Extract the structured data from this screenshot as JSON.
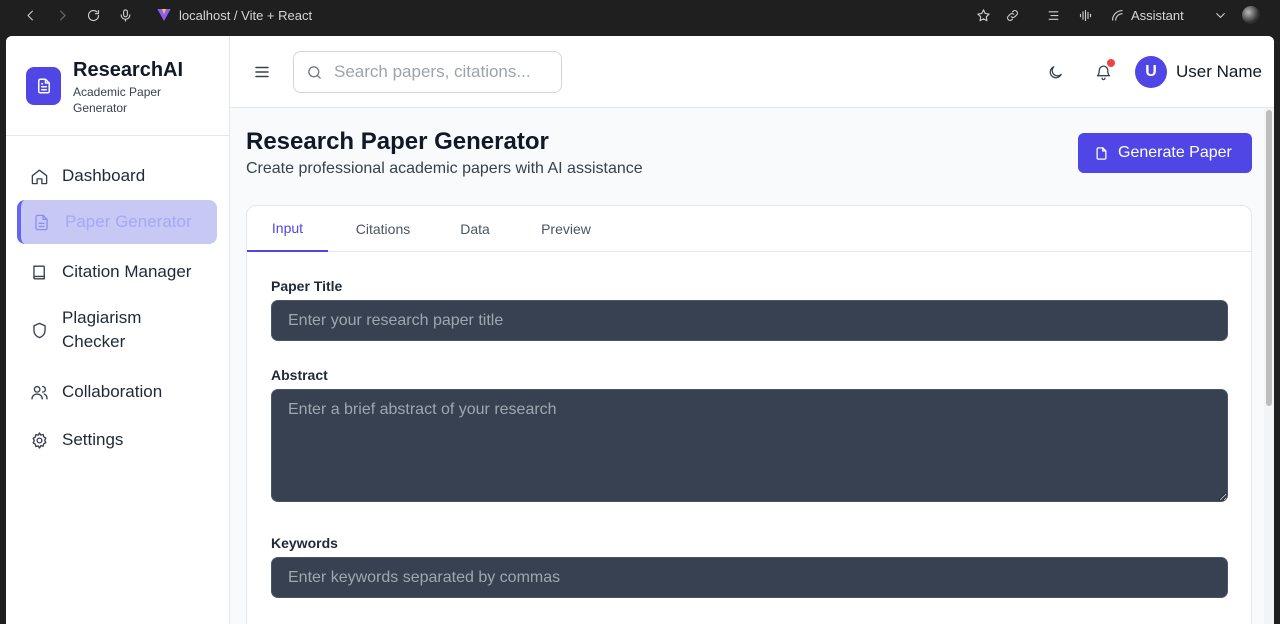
{
  "browser": {
    "url_text": "localhost / Vite + React",
    "assistant_label": "Assistant"
  },
  "brand": {
    "title": "ResearchAI",
    "subtitle": "Academic Paper Generator",
    "color": "#4f46e5"
  },
  "sidebar": {
    "items": [
      {
        "label": "Dashboard",
        "icon": "home-icon"
      },
      {
        "label": "Paper Generator",
        "icon": "document-icon",
        "active": true
      },
      {
        "label": "Citation Manager",
        "icon": "book-icon"
      },
      {
        "label": "Plagiarism Checker",
        "icon": "shield-icon"
      },
      {
        "label": "Collaboration",
        "icon": "users-icon"
      },
      {
        "label": "Settings",
        "icon": "gear-icon"
      }
    ]
  },
  "header": {
    "search_placeholder": "Search papers, citations...",
    "user_initial": "U",
    "user_name": "User Name"
  },
  "main": {
    "title": "Research Paper Generator",
    "subtitle": "Create professional academic papers with AI assistance",
    "generate_label": "Generate Paper",
    "tabs": [
      {
        "label": "Input",
        "active": true
      },
      {
        "label": "Citations"
      },
      {
        "label": "Data"
      },
      {
        "label": "Preview"
      }
    ],
    "fields": {
      "title_label": "Paper Title",
      "title_placeholder": "Enter your research paper title",
      "abstract_label": "Abstract",
      "abstract_placeholder": "Enter a brief abstract of your research",
      "keywords_label": "Keywords",
      "keywords_placeholder": "Enter keywords separated by commas"
    }
  }
}
